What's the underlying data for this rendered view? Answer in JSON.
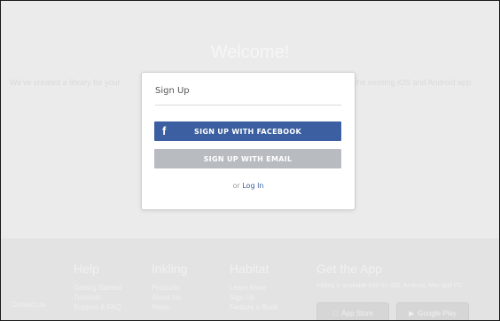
{
  "background": {
    "welcome": "Welcome!",
    "subtext_left": "We've created a library for your",
    "subtext_right": "the existing iOS and Android app."
  },
  "modal": {
    "title": "Sign Up",
    "facebook_button": "SIGN UP WITH FACEBOOK",
    "email_button": "SIGN UP WITH EMAIL",
    "login_prefix": "or",
    "login_link": "Log In"
  },
  "footer": {
    "left_link": "Contact us",
    "columns": [
      {
        "title": "Help",
        "links": [
          "Getting Started",
          "Tutorials",
          "Support & FAQ"
        ]
      },
      {
        "title": "Inkling",
        "links": [
          "Products",
          "About Us",
          "News"
        ]
      },
      {
        "title": "Habitat",
        "links": [
          "Learn More",
          "Sign Up",
          "Feature a Book"
        ]
      }
    ],
    "app": {
      "title": "Get the App",
      "description": "Inkling is available free for iOS, Android, Mac and PC",
      "app_store": "App Store",
      "google_play": "Google Play"
    }
  },
  "colors": {
    "facebook": "#3b5fa0",
    "email": "#b8bcc1",
    "overlay": "#ebebeb"
  }
}
